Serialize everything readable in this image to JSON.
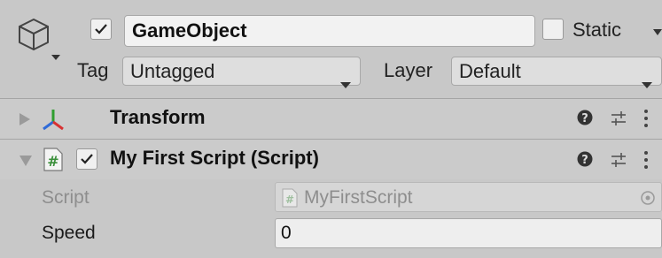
{
  "header": {
    "active": true,
    "name": "GameObject",
    "static_label": "Static",
    "static_checked": false,
    "tag_label": "Tag",
    "tag_value": "Untagged",
    "layer_label": "Layer",
    "layer_value": "Default"
  },
  "components": [
    {
      "title": "Transform",
      "expanded": false,
      "icon": "transform-gizmo-icon"
    },
    {
      "title": "My First Script (Script)",
      "expanded": true,
      "enabled": true,
      "icon": "script-hash-icon",
      "fields": [
        {
          "label": "Script",
          "value": "MyFirstScript",
          "disabled": true
        },
        {
          "label": "Speed",
          "value": "0"
        }
      ]
    }
  ],
  "colors": {
    "panel_bg": "#c8c8c8",
    "transform_red": "#d83232",
    "transform_green": "#2f9e2f",
    "transform_blue": "#2f6bd8",
    "script_icon_green": "#3a8f3a"
  }
}
